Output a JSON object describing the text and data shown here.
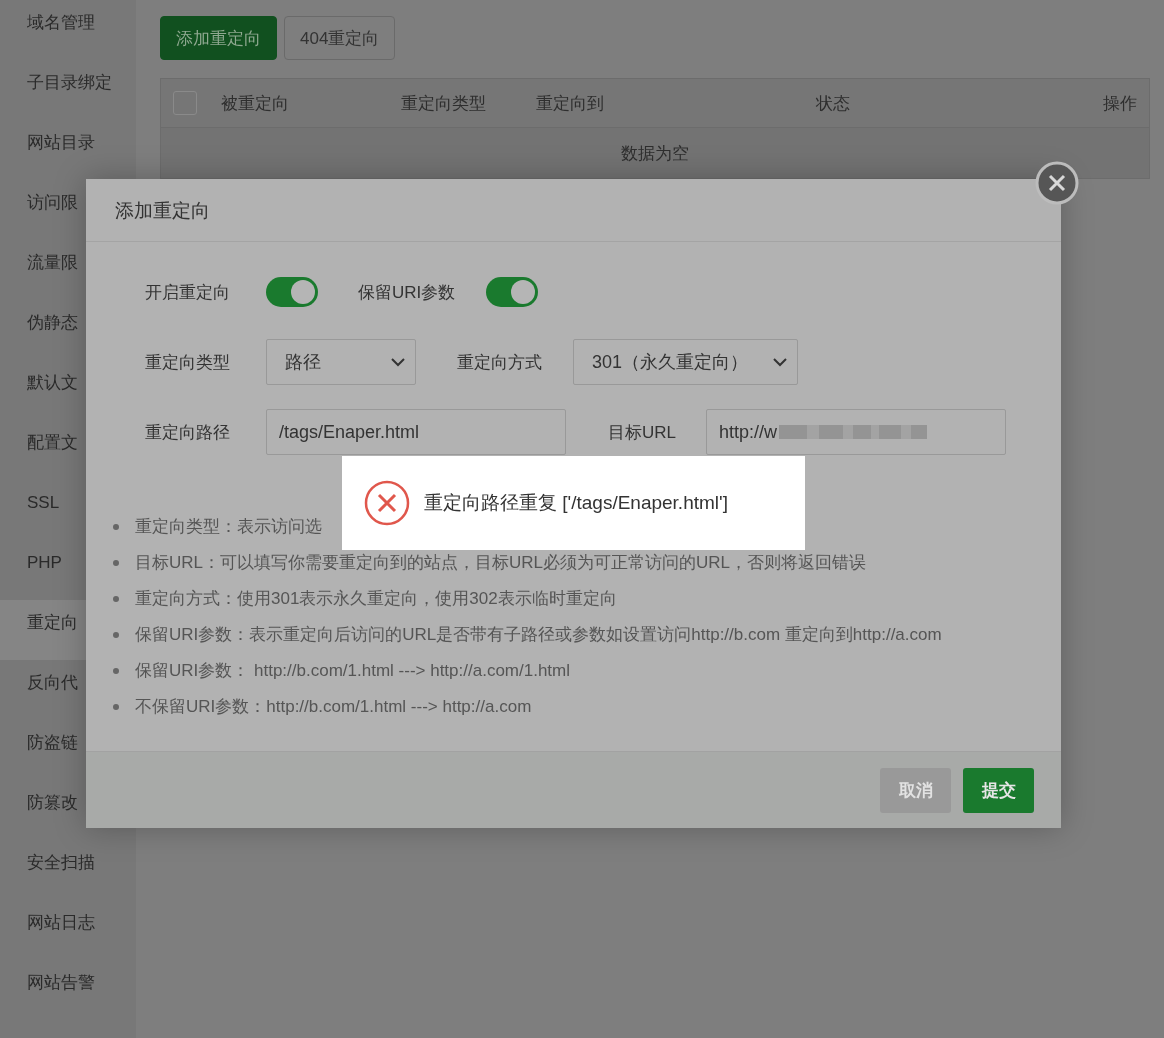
{
  "sidebar": {
    "items": [
      {
        "label": "域名管理",
        "selected": false
      },
      {
        "label": "子目录绑定",
        "selected": false
      },
      {
        "label": "网站目录",
        "selected": false
      },
      {
        "label": "访问限",
        "selected": false
      },
      {
        "label": "流量限",
        "selected": false
      },
      {
        "label": "伪静态",
        "selected": false
      },
      {
        "label": "默认文",
        "selected": false
      },
      {
        "label": "配置文",
        "selected": false
      },
      {
        "label": "SSL",
        "selected": false
      },
      {
        "label": "PHP",
        "selected": false
      },
      {
        "label": "重定向",
        "selected": true
      },
      {
        "label": "反向代",
        "selected": false
      },
      {
        "label": "防盗链",
        "selected": false
      },
      {
        "label": "防篡改",
        "selected": false
      },
      {
        "label": "安全扫描",
        "selected": false
      },
      {
        "label": "网站日志",
        "selected": false
      },
      {
        "label": "网站告警",
        "selected": false
      }
    ]
  },
  "toolbar": {
    "buttons": [
      {
        "label": "添加重定向",
        "kind": "primary"
      },
      {
        "label": "404重定向",
        "kind": "plain"
      }
    ]
  },
  "table": {
    "select_all": {
      "checked": false
    },
    "columns": [
      "被重定向",
      "重定向类型",
      "重定向到",
      "状态",
      "操作"
    ],
    "empty_text": "数据为空"
  },
  "dialog": {
    "title": "添加重定向",
    "toggles": [
      {
        "label": "开启重定向",
        "on": true
      },
      {
        "label": "保留URI参数",
        "on": true
      }
    ],
    "selects": [
      {
        "label": "重定向类型",
        "value": "路径"
      },
      {
        "label": "重定向方式",
        "value": "301（永久重定向）"
      }
    ],
    "fields": [
      {
        "label": "重定向路径",
        "value": "/tags/Enaper.html",
        "blurred": false
      },
      {
        "label": "目标URL",
        "value": "http://w",
        "blurred": true
      }
    ],
    "notes": [
      "重定向类型：表示访问选",
      "目标URL：可以填写你需要重定向到的站点，目标URL必须为可正常访问的URL，否则将返回错误",
      "重定向方式：使用301表示永久重定向，使用302表示临时重定向",
      "保留URI参数：表示重定向后访问的URL是否带有子路径或参数如设置访问http://b.com 重定向到http://a.com",
      "保留URI参数：  http://b.com/1.html ---> http://a.com/1.html",
      "不保留URI参数：http://b.com/1.html ---> http://a.com"
    ],
    "buttons": [
      {
        "label": "取消",
        "kind": "cancel"
      },
      {
        "label": "提交",
        "kind": "submit"
      }
    ]
  },
  "toast": {
    "message": "重定向路径重复 ['/tags/Enaper.html']"
  }
}
